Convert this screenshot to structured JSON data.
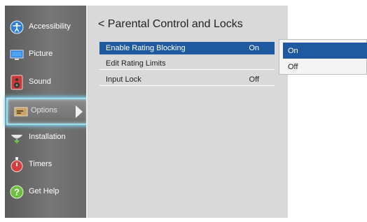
{
  "sidebar": {
    "items": [
      {
        "label": "Accessibility",
        "icon": "accessibility-icon"
      },
      {
        "label": "Picture",
        "icon": "picture-icon"
      },
      {
        "label": "Sound",
        "icon": "speaker-icon"
      },
      {
        "label": "Options",
        "icon": "options-icon"
      },
      {
        "label": "Installation",
        "icon": "satellite-dish-icon"
      },
      {
        "label": "Timers",
        "icon": "timer-icon"
      },
      {
        "label": "Get Help",
        "icon": "help-icon"
      }
    ],
    "selected_index": 3
  },
  "main": {
    "title": "< Parental Control and Locks",
    "rows": [
      {
        "label": "Enable Rating Blocking",
        "value": "On",
        "selected": true
      },
      {
        "label": "Edit Rating Limits",
        "value": ""
      },
      {
        "label": "Input Lock",
        "value": "Off"
      }
    ]
  },
  "popup": {
    "options": [
      {
        "label": "On",
        "selected": true
      },
      {
        "label": "Off",
        "selected": false
      }
    ]
  },
  "colors": {
    "accent": "#1f5aa0",
    "highlight_glow": "#7ecde8",
    "sidebar_bg": "#6f6f6f",
    "panel_bg": "#d9d9d9"
  }
}
